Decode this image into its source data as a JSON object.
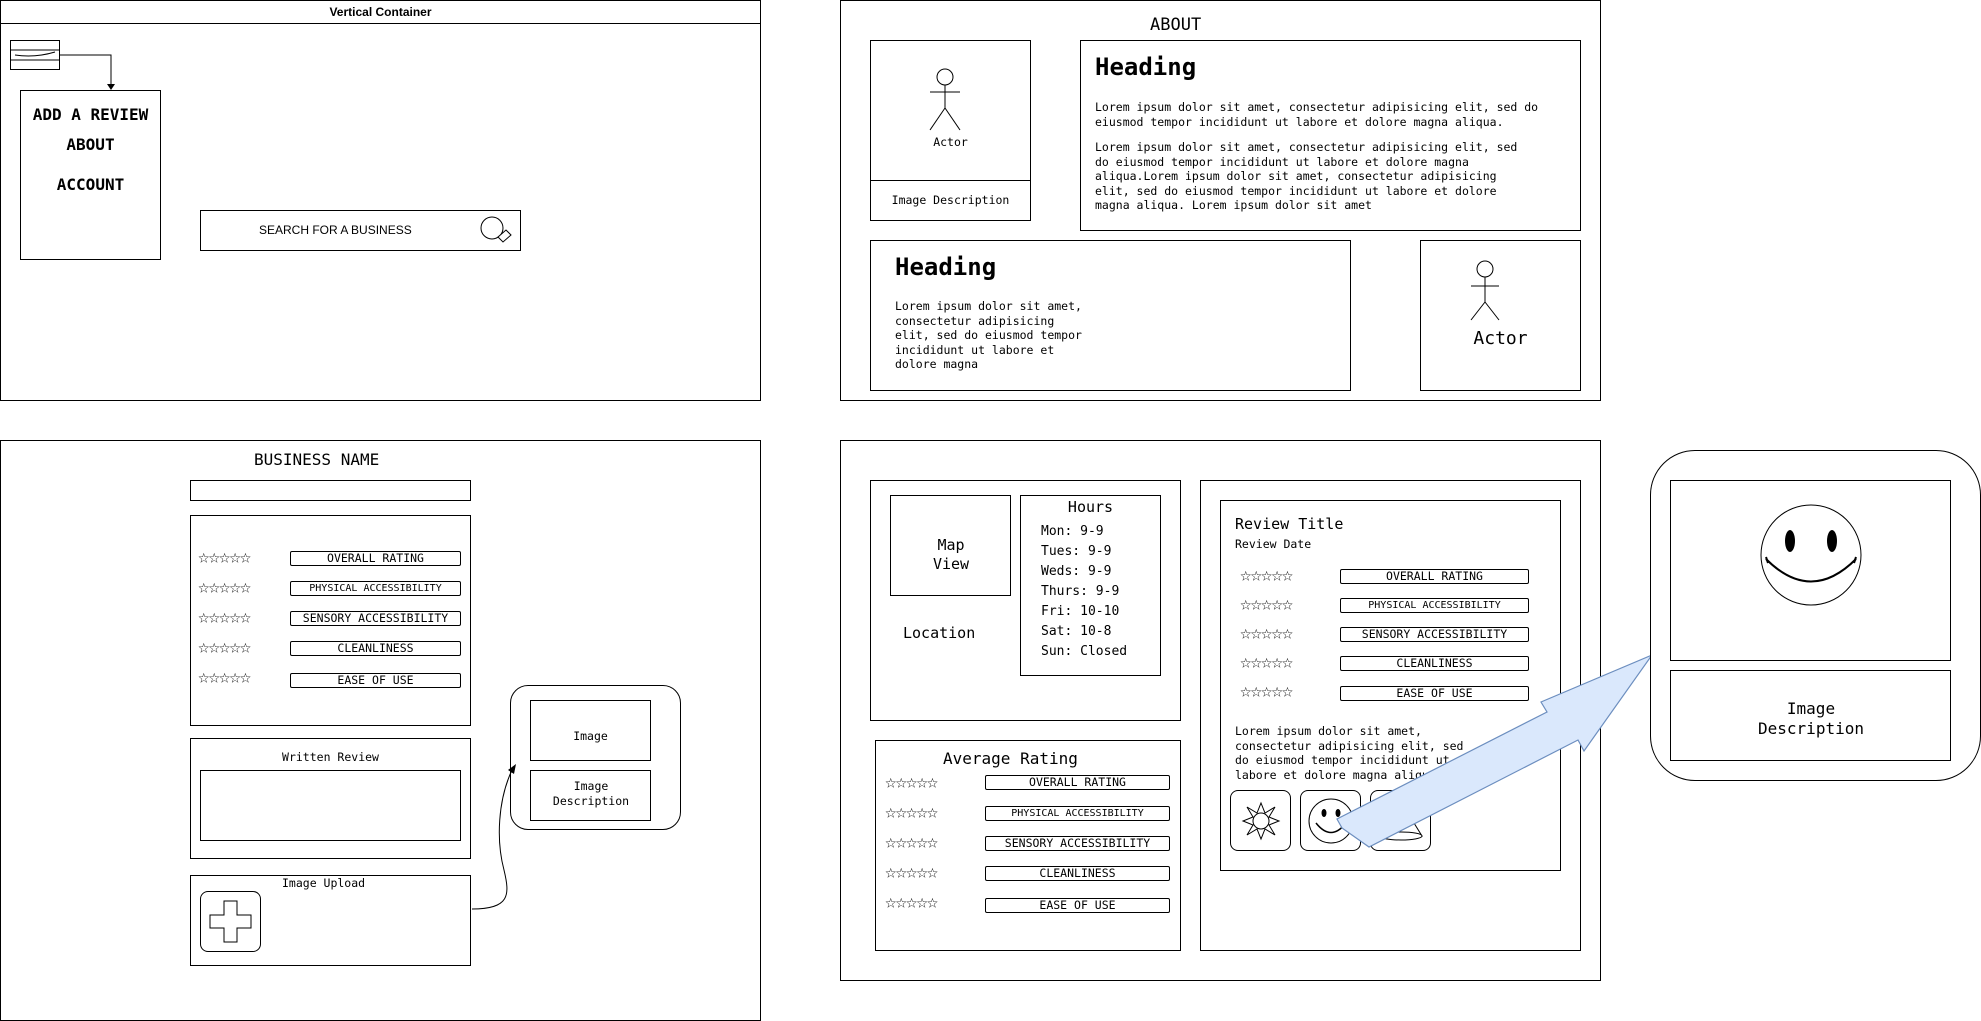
{
  "top_left": {
    "title": "Vertical Container",
    "menu": [
      "ADD A REVIEW",
      "ABOUT",
      "ACCOUNT"
    ],
    "search_label": "SEARCH FOR A BUSINESS",
    "icons": [
      "hamburger-menu-icon",
      "magnifier-icon"
    ]
  },
  "about": {
    "title": "ABOUT",
    "actor1": "Actor",
    "image_description": "Image Description",
    "heading1": "Heading",
    "para1": "Lorem ipsum dolor sit amet, consectetur adipisicing elit, sed do eiusmod tempor incididunt ut labore et dolore magna aliqua.",
    "para2": "Lorem ipsum dolor sit amet, consectetur adipisicing elit, sed do eiusmod tempor incididunt ut labore et dolore magna aliqua.Lorem ipsum dolor sit amet, consectetur adipisicing elit, sed do eiusmod tempor incididunt ut labore et dolore magna aliqua. Lorem ipsum dolor sit amet",
    "heading2": "Heading",
    "para3": "Lorem ipsum dolor sit amet, consectetur adipisicing elit, sed do eiusmod tempor incididunt ut labore et dolore magna",
    "actor2": "Actor"
  },
  "business": {
    "title": "BUSINESS NAME",
    "ratings": [
      "OVERALL RATING",
      "PHYSICAL ACCESSIBILITY",
      "SENSORY ACCESSIBILITY",
      "CLEANLINESS",
      "EASE OF USE"
    ],
    "written_review": "Written Review",
    "image_upload": "Image Upload",
    "popup_image": "Image",
    "popup_desc": "Image Description"
  },
  "detail": {
    "map_view": "Map View",
    "location": "Location",
    "hours_title": "Hours",
    "hours": [
      "Mon: 9-9",
      "Tues: 9-9",
      "Weds: 9-9",
      "Thurs: 9-9",
      "Fri: 10-10",
      "Sat: 10-8",
      "Sun: Closed"
    ],
    "average_rating": "Average Rating",
    "ratings": [
      "OVERALL RATING",
      "PHYSICAL ACCESSIBILITY",
      "SENSORY ACCESSIBILITY",
      "CLEANLINESS",
      "EASE OF USE"
    ],
    "review_title": "Review Title",
    "review_date": "Review Date",
    "review_ratings": [
      "OVERALL RATING",
      "PHYSICAL ACCESSIBILITY",
      "SENSORY ACCESSIBILITY",
      "CLEANLINESS",
      "EASE OF USE"
    ],
    "review_text": "Lorem ipsum dolor sit amet, consectetur adipisicing elit, sed do eiusmod tempor incididunt ut labore et dolore magna aliqua.",
    "thumb_icons": [
      "sun-icon",
      "smiley-icon",
      "cone-icon"
    ],
    "enlarged_desc": "Image Description"
  },
  "stars_glyph": "☆☆☆☆☆"
}
